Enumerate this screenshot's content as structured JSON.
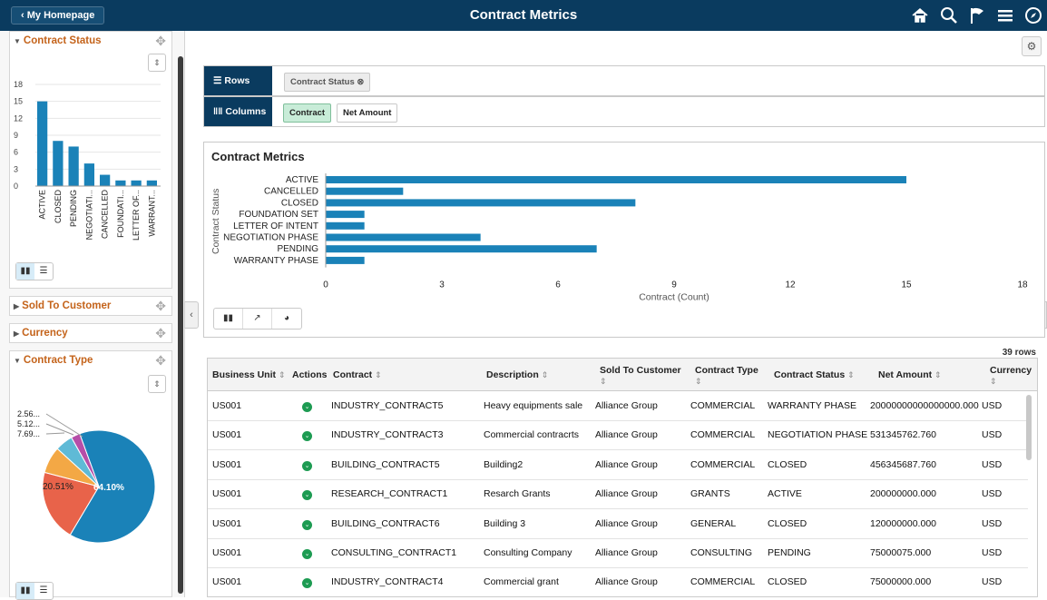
{
  "topbar": {
    "home_label": "My Homepage",
    "title": "Contract Metrics",
    "icons": [
      "home-icon",
      "search-icon",
      "flag-icon",
      "menu-icon",
      "compass-icon"
    ]
  },
  "left_panel": {
    "contract_status": {
      "title": "Contract Status",
      "chart_data": {
        "type": "bar",
        "categories": [
          "ACTIVE",
          "CLOSED",
          "PENDING",
          "NEGOTIATI...",
          "CANCELLED",
          "FOUNDATI...",
          "LETTER OF...",
          "WARRANT..."
        ],
        "values": [
          15,
          8,
          7,
          4,
          2,
          1,
          1,
          1
        ],
        "ylim": [
          0,
          18
        ],
        "yticks": [
          0,
          3,
          6,
          9,
          12,
          15,
          18
        ]
      }
    },
    "sold_to_customer": {
      "title": "Sold To Customer"
    },
    "currency": {
      "title": "Currency"
    },
    "contract_type": {
      "title": "Contract Type",
      "chart_data": {
        "type": "pie",
        "slice_labels": [
          "64.10%",
          "20.51%",
          "7.69...",
          "5.12...",
          "2.56..."
        ],
        "values": [
          64.1,
          20.51,
          7.69,
          5.12,
          2.56
        ],
        "colors": [
          "#1a82b8",
          "#e8634a",
          "#f3a845",
          "#5fbad6",
          "#b64ea8"
        ]
      }
    }
  },
  "pivot": {
    "rows_label": "Rows",
    "row_chip": "Contract Status",
    "columns_label": "Columns",
    "col_chips": [
      "Contract",
      "Net Amount"
    ]
  },
  "main_chart": {
    "title": "Contract Metrics",
    "chart_data": {
      "type": "bar",
      "orientation": "horizontal",
      "categories": [
        "ACTIVE",
        "CANCELLED",
        "CLOSED",
        "FOUNDATION SET",
        "LETTER OF INTENT",
        "NEGOTIATION PHASE",
        "PENDING",
        "WARRANTY PHASE"
      ],
      "values": [
        15,
        2,
        8,
        1,
        1,
        4,
        7,
        1
      ],
      "xlim": [
        0,
        18
      ],
      "xticks": [
        0,
        3,
        6,
        9,
        12,
        15,
        18
      ],
      "xlabel": "Contract (Count)",
      "ylabel": "Contract Status",
      "color": "#1a82b8"
    }
  },
  "grid": {
    "row_count": "39 rows",
    "headers": {
      "business_unit": "Business Unit",
      "actions": "Actions",
      "contract": "Contract",
      "description": "Description",
      "sold_to": "Sold To Customer",
      "contract_type": "Contract Type",
      "contract_status": "Contract Status",
      "net_amount": "Net Amount",
      "currency": "Currency"
    },
    "rows": [
      [
        "US001",
        "INDUSTRY_CONTRACT5",
        "Heavy equipments sale",
        "Alliance Group",
        "COMMERCIAL",
        "WARRANTY PHASE",
        "20000000000000000.000",
        "USD"
      ],
      [
        "US001",
        "INDUSTRY_CONTRACT3",
        "Commercial contracrts",
        "Alliance Group",
        "COMMERCIAL",
        "NEGOTIATION PHASE",
        "531345762.760",
        "USD"
      ],
      [
        "US001",
        "BUILDING_CONTRACT5",
        "Building2",
        "Alliance Group",
        "COMMERCIAL",
        "CLOSED",
        "456345687.760",
        "USD"
      ],
      [
        "US001",
        "RESEARCH_CONTRACT1",
        "Resarch Grants",
        "Alliance Group",
        "GRANTS",
        "ACTIVE",
        "200000000.000",
        "USD"
      ],
      [
        "US001",
        "BUILDING_CONTRACT6",
        "Building 3",
        "Alliance Group",
        "GENERAL",
        "CLOSED",
        "120000000.000",
        "USD"
      ],
      [
        "US001",
        "CONSULTING_CONTRACT1",
        "Consulting Company",
        "Alliance Group",
        "CONSULTING",
        "PENDING",
        "75000075.000",
        "USD"
      ],
      [
        "US001",
        "INDUSTRY_CONTRACT4",
        "Commercial grant",
        "Alliance Group",
        "COMMERCIAL",
        "CLOSED",
        "75000000.000",
        "USD"
      ]
    ]
  }
}
